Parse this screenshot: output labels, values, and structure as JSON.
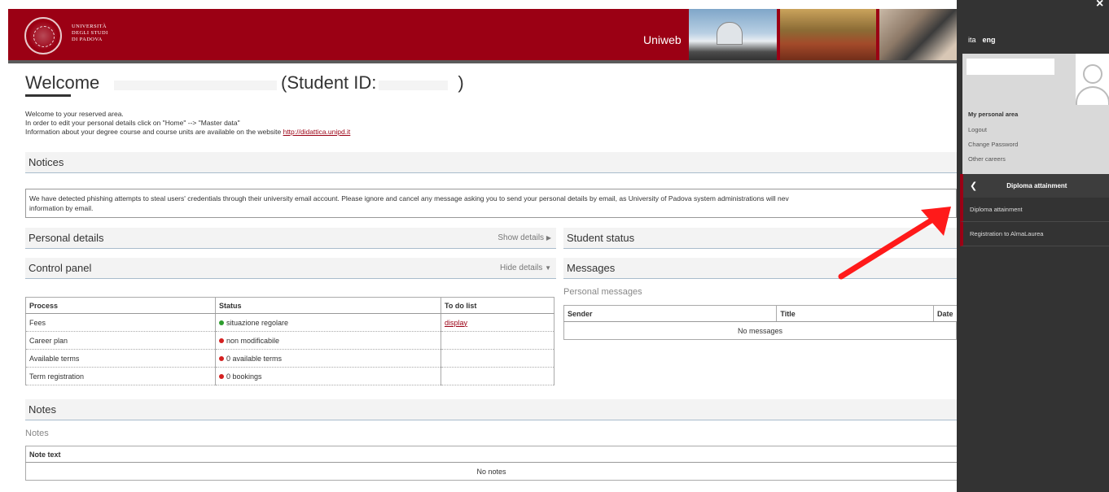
{
  "header": {
    "university_lines": [
      "Università",
      "degli Studi",
      "di Padova"
    ],
    "app_name": "Uniweb"
  },
  "welcome": {
    "title": "Welcome",
    "student_id_label": "(Student ID:",
    "closing_paren": ")",
    "lines": [
      "Welcome to your reserved area.",
      "In order to edit your personal details click on \"Home\" --> \"Master data\"",
      "Information about your degree course and course units are available on the website "
    ],
    "link": "http://didattica.unipd.it"
  },
  "notices": {
    "title": "Notices",
    "text": "We have detected phishing attempts to steal users' credentials through their university email account. Please ignore and cancel any message asking you to send your personal details by email, as University of Padova system administrations will nev",
    "text2": "information by email."
  },
  "personal_details": {
    "title": "Personal details",
    "toggle": "Show details"
  },
  "control_panel": {
    "title": "Control panel",
    "toggle": "Hide details",
    "headers": [
      "Process",
      "Status",
      "To do list"
    ],
    "rows": [
      {
        "process": "Fees",
        "status": "situazione regolare",
        "status_color": "green",
        "todo": "display"
      },
      {
        "process": "Career plan",
        "status": "non modificabile",
        "status_color": "red",
        "todo": ""
      },
      {
        "process": "Available terms",
        "status": "0 available terms",
        "status_color": "red",
        "todo": ""
      },
      {
        "process": "Term registration",
        "status": "0 bookings",
        "status_color": "red",
        "todo": ""
      }
    ]
  },
  "student_status": {
    "title": "Student status"
  },
  "messages": {
    "title": "Messages",
    "subtitle": "Personal messages",
    "headers": [
      "Sender",
      "Title",
      "Date"
    ],
    "empty": "No messages"
  },
  "notes": {
    "title": "Notes",
    "subtitle": "Notes",
    "header": "Note text",
    "empty": "No notes"
  },
  "sidebar": {
    "lang_ita": "ita",
    "lang_eng": "eng",
    "personal_area": "My personal area",
    "links": [
      "Logout",
      "Change Password",
      "Other careers"
    ],
    "menu_title": "Diploma attainment",
    "menu_items": [
      "Diploma attainment",
      "Registration to AlmaLaurea"
    ],
    "close": "×"
  },
  "colors": {
    "brand": "#9b0014",
    "sidebar": "#333333",
    "arrow": "#ff1a1a"
  }
}
